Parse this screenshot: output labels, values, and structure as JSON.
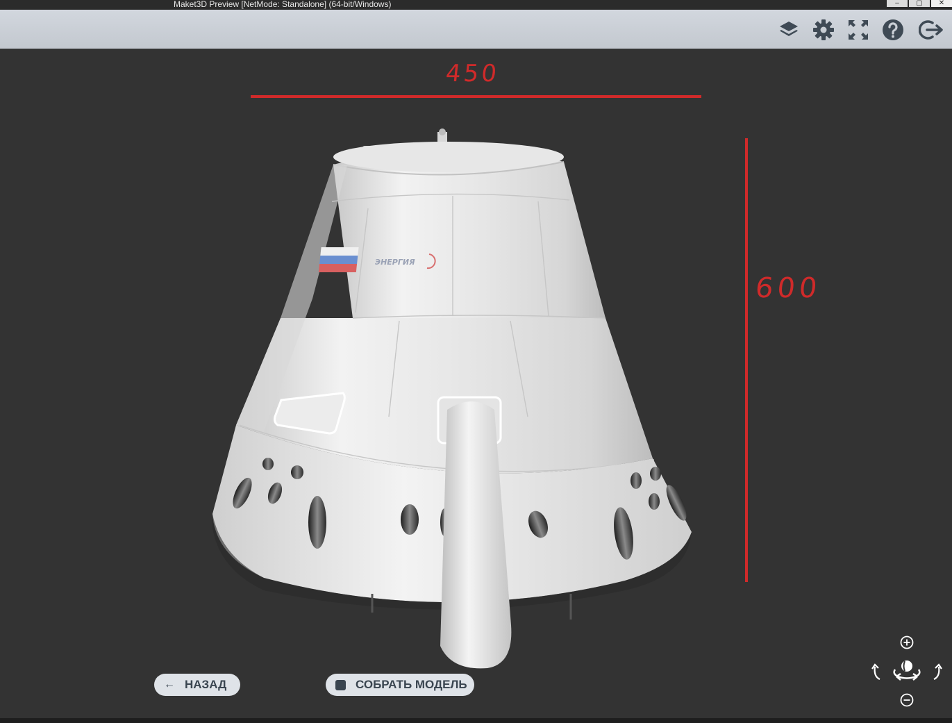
{
  "window": {
    "title": "Maket3D Preview [NetMode: Standalone]  (64-bit/Windows)",
    "controls": [
      "–",
      "▢",
      "✕"
    ]
  },
  "toolbar": {
    "icons": [
      "layers-icon",
      "gear-icon",
      "fullscreen-icon",
      "help-icon",
      "exit-icon"
    ]
  },
  "annotations": {
    "width_label": "450",
    "height_label": "600",
    "color": "#d02a2a"
  },
  "model": {
    "logo_text": "ЭНЕРГИЯ"
  },
  "buttons": {
    "back": {
      "icon": "←",
      "label": "НАЗАД"
    },
    "assemble": {
      "label": "СОБРАТЬ МОДЕЛЬ"
    }
  },
  "nav": {
    "zoom_in": "zoom-in-icon",
    "zoom_out": "zoom-out-icon",
    "rotate_left": "rotate-left-icon",
    "rotate_right": "rotate-right-icon",
    "orbit": "orbit-icon"
  },
  "colors": {
    "background": "#333333",
    "toolbar": "#c9ced5",
    "icon": "#3f4a55",
    "model": "#e8e8e8"
  }
}
